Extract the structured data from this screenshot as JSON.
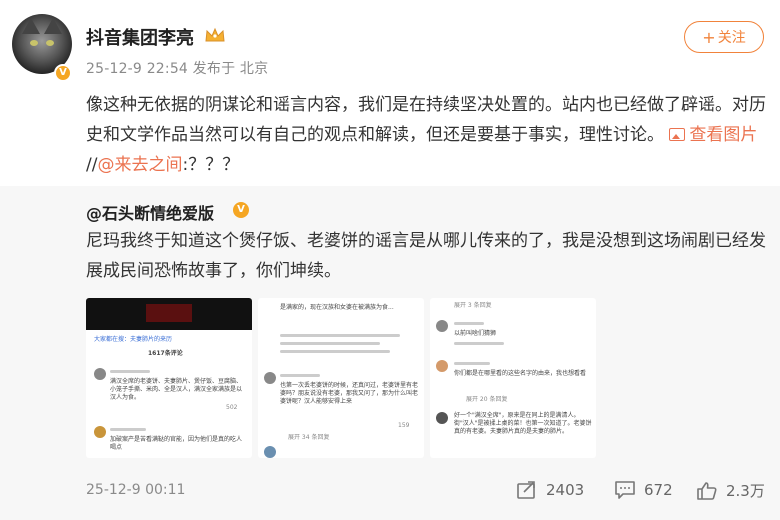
{
  "post": {
    "author": "抖音集团李亮",
    "meta": "25-12-9 22:54 发布于 北京",
    "follow_label": "关注",
    "follow_plus": "+",
    "content_main": "像这种无依据的阴谋论和谣言内容，我们是在持续坚决处置的。站内也已经做了辟谣。对历史和文学作品当然可以有自己的观点和解读，但还是要基于事实，理性讨论。",
    "view_pictures": "查看图片",
    "repost_sep": "//",
    "mention": "@来去之间",
    "tail": ":？？？"
  },
  "repost": {
    "author": "@石头断情绝爱版",
    "content": "尼玛我终于知道这个煲仔饭、老婆饼的谣言是从哪儿传来的了，我是没想到这场闹剧已经发展成民间恐怖故事了，你们坤续。",
    "thumbs": [
      {
        "header": "大家都在搜：夫妻肺片的来历",
        "count": "1617条评论",
        "c1": "满汉全席的老婆饼、夫妻肺片、煲仔饭、豆腐脑、小笼子手撕、米肉、全是汉人，满汉全家满族是以汉人为食。",
        "c2": "加破案产是苦看满鞑的官能，因为他们是真的吃人喝点",
        "likes": "502"
      },
      {
        "c1": "是满家的，现在汉族和女婆在被满族为食...",
        "c2": "也第一次丢老婆饼的时候，还真问过，老婆饼里有老婆吗？朋友说没有老婆，那我又问了，那为什么叫老婆饼呢？汉人能够安得上来",
        "likes": "159",
        "more": "展开 34 条回复"
      },
      {
        "more": "展开 3 条回复",
        "c1": "以前叫啥们猜狮",
        "c2": "你们都是在哪里看的这些名字的由来，我也想看看",
        "c3": "好一个\"满汉全席\"，原来是在同上的是满清人。街\"汉人\"是被揉上桌的菜！也第一次知道了。老婆饼真的有老婆。夫妻肺片真的是夫妻的肺片。",
        "more2": "展开 20 条回复"
      }
    ]
  },
  "footer": {
    "time": "25-12-9 00:11",
    "reposts": "2403",
    "comments": "672",
    "likes": "2.3万"
  }
}
